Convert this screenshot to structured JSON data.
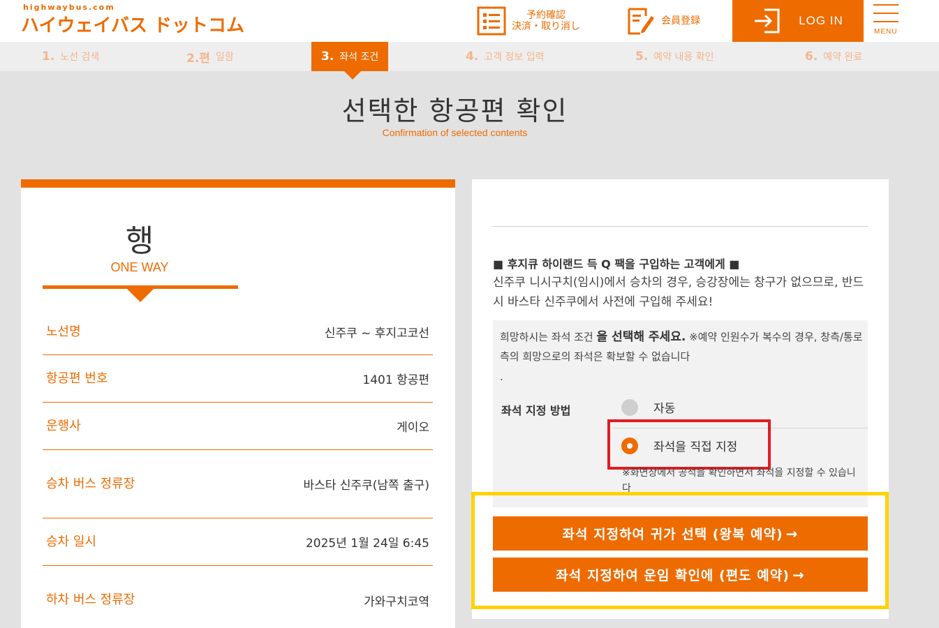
{
  "header": {
    "logo_small": "highwaybus.com",
    "logo_main": "ハイウェイバス ドットコム",
    "reservation_link": {
      "line1": "予約確認",
      "line2": "決済・取り消し"
    },
    "register_link": "会員登録",
    "login_label": "LOG IN",
    "menu_label": "MENU"
  },
  "steps": [
    {
      "num": "1.",
      "label": "노선 검색"
    },
    {
      "num": "2.편",
      "label": "일람"
    },
    {
      "num": "3.",
      "label": "좌석 조건"
    },
    {
      "num": "4.",
      "label": "고객 정보 입력"
    },
    {
      "num": "5.",
      "label": "예약 내용 확인"
    },
    {
      "num": "6.",
      "label": "예약 완료"
    }
  ],
  "page": {
    "title": "선택한 항공편 확인",
    "subtitle": "Confirmation of selected contents"
  },
  "left_card": {
    "direction_char": "행",
    "direction_en": "ONE WAY",
    "rows": [
      {
        "key": "노선명",
        "value": "신주쿠 ~ 후지고코선"
      },
      {
        "key": "항공편 번호",
        "value": "1401 항공편"
      },
      {
        "key": "운행사",
        "value": "게이오"
      },
      {
        "key": "승차 버스 정류장",
        "value": "바스타 신주쿠(남쪽 출구)"
      },
      {
        "key": "승차 일시",
        "value": "2025년 1월 24일 6:45"
      },
      {
        "key": "하차 버스 정류장",
        "value": "가와구치코역"
      }
    ]
  },
  "right_card": {
    "notice_title": "■ 후지큐 하이랜드 득 Q 팩을 구입하는 고객에게 ■",
    "notice_body": "신주쿠 니시구치(임시)에서 승차의 경우, 승강장에는 창구가 없으므로, 반드시 바스타 신주쿠에서 사전에 구입해 주세요!",
    "instruction_pre": "희망하시는 좌석 조건 ",
    "instruction_bold": "을 선택해 주세요.",
    "instruction_post": " ※예약 인원수가 복수의 경우, 창측/통로측의 희망으로의 좌석은 확보할 수 없습니다",
    "instruction_dot": ".",
    "seat_method_label": "좌석 지정 방법",
    "option_auto": "자동",
    "option_manual": "좌석을 직접 지정",
    "manual_note": "※화면상에서 공석을 확인하면서 좌석을 지정할 수 있습니다"
  },
  "actions": {
    "round_trip": "좌석 지정하여 귀가 선택 (왕복 예약)",
    "one_way": "좌석 지정하여 운임 확인에 (편도 예약)",
    "arrow": "→"
  },
  "colors": {
    "accent": "#ee6b00",
    "highlight_red": "#e21b23",
    "highlight_yellow": "#ffd200"
  }
}
